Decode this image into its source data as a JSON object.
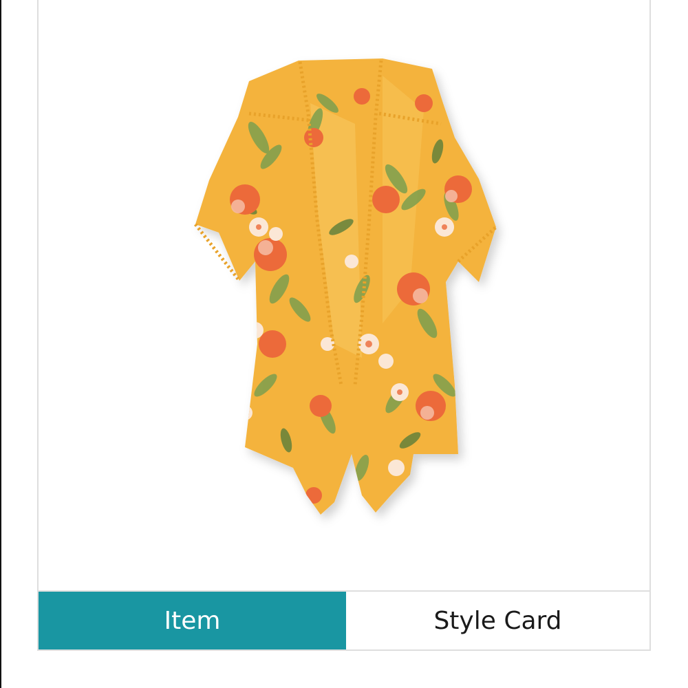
{
  "product": {
    "image_icon": "floral-kimono-image",
    "colors": {
      "base": "#f4b33d",
      "light": "#f7c55a",
      "flower": "#ec6a3a",
      "flower_light": "#f5b9a0",
      "blossom": "#fbe7d6",
      "leaf": "#7d9f4e",
      "leaf_dark": "#5a7d3a",
      "trim": "#e8a22a"
    }
  },
  "tabs": [
    {
      "label": "Item",
      "active": true
    },
    {
      "label": "Style Card",
      "active": false
    }
  ],
  "colors": {
    "active_tab": "#1996a2",
    "border": "#dedede"
  }
}
